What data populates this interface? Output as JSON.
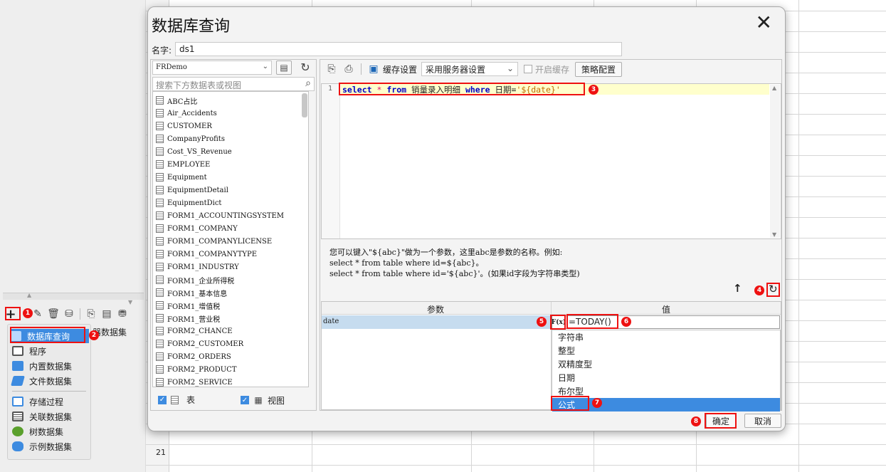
{
  "left_panel": {
    "toolbar_icons": [
      "plus-icon",
      "pencil-icon",
      "trash-icon",
      "database-icon",
      "preview-icon",
      "edit-ds-icon",
      "db-settings-icon"
    ],
    "behind_label": "器数据集",
    "menu_items": [
      {
        "label": "数据库查询",
        "icon": "database-icon",
        "color": "#3d8be0"
      },
      {
        "label": "程序",
        "icon": "monitor-icon",
        "color": "#555555"
      },
      {
        "label": "内置数据集",
        "icon": "grid-icon",
        "color": "#3d8be0"
      },
      {
        "label": "文件数据集",
        "icon": "file-icon",
        "color": "#3d8be0"
      },
      {
        "label": "存储过程",
        "icon": "procedure-icon",
        "color": "#3d8be0"
      },
      {
        "label": "关联数据集",
        "icon": "relation-icon",
        "color": "#555555"
      },
      {
        "label": "树数据集",
        "icon": "tree-icon",
        "color": "#5aa02c"
      },
      {
        "label": "示例数据集",
        "icon": "sample-icon",
        "color": "#3d8be0"
      }
    ]
  },
  "sheet": {
    "row_label": "21"
  },
  "dialog": {
    "title": "数据库查询",
    "name_label": "名字:",
    "name_value": "ds1",
    "connection": "FRDemo",
    "search_placeholder": "搜索下方数据表或视图",
    "tables": [
      "ABC占比",
      "Air_Accidents",
      "CUSTOMER",
      "CompanyProfits",
      "Cost_VS_Revenue",
      "EMPLOYEE",
      "Equipment",
      "EquipmentDetail",
      "EquipmentDict",
      "FORM1_ACCOUNTINGSYSTEM",
      "FORM1_COMPANY",
      "FORM1_COMPANYLICENSE",
      "FORM1_COMPANYTYPE",
      "FORM1_INDUSTRY",
      "FORM1_企业所得税",
      "FORM1_基本信息",
      "FORM1_增值税",
      "FORM1_营业税",
      "FORM2_CHANCE",
      "FORM2_CUSTOMER",
      "FORM2_ORDERS",
      "FORM2_PRODUCT",
      "FORM2_SERVICE"
    ],
    "checkbox_table_label": "表",
    "checkbox_view_label": "视图",
    "cache_label": "缓存设置",
    "server_setting": "采用服务器设置",
    "enable_cache_label": "开启缓存",
    "strategy_button": "策略配置",
    "sql": {
      "line_no": "1",
      "kw_select": "select",
      "star": "*",
      "kw_from": "from",
      "table": "销量录入明细",
      "kw_where": "where",
      "field": "日期=",
      "value": "'${date}'"
    },
    "hint_lines": [
      "您可以键入\"${abc}\"做为一个参数，这里abc是参数的名称。例如:",
      "select * from table where id=${abc}。",
      "select * from table where id='${abc}'。(如果id字段为字符串类型)"
    ],
    "param_header": "参数",
    "value_header": "值",
    "param_name": "date",
    "formula_button": "F(x)",
    "param_value": "=TODAY()",
    "type_options": [
      "字符串",
      "整型",
      "双精度型",
      "日期",
      "布尔型",
      "公式"
    ],
    "selected_type": "公式",
    "ok_button": "确定",
    "cancel_button": "取消"
  },
  "badges": [
    "1",
    "2",
    "3",
    "4",
    "5",
    "6",
    "7",
    "8"
  ],
  "colors": {
    "accent": "#3d8be0",
    "marker": "#e11111",
    "sql_highlight": "#ffffcc",
    "selection": "#c6dcef"
  }
}
